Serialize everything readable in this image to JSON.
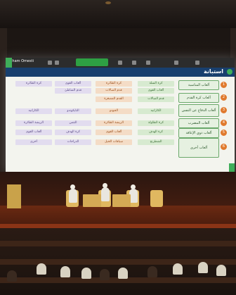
{
  "zoom": {
    "participant_name": "Raham Omesti",
    "poll_label": ""
  },
  "survey": {
    "title": "استبانة"
  },
  "categories": [
    {
      "num": "1",
      "label": "ألعاب المناسبة"
    },
    {
      "num": "2",
      "label": "ألعاب كرة القدم"
    },
    {
      "num": "3",
      "label": "ألعاب الدفاع عن النفس"
    },
    {
      "num": "4",
      "label": "ألعاب المضرب"
    },
    {
      "num": "5",
      "label": "ألعاب ذوي الإعاقة"
    },
    {
      "num": "6",
      "label": "ألعاب أخرى"
    }
  ],
  "grid": [
    [
      "كرة السلة",
      "كرة الطائرة",
      "ألعاب القوى",
      "كرة الطائرة"
    ],
    [
      "ألعاب القوى",
      "قدم الصالات",
      "قدم الشاطئ",
      ""
    ],
    [
      "قدم الصالات",
      "القدم المصغرة",
      "",
      ""
    ],
    [
      "الكاراتيه",
      "الجودو",
      "التايكوندو",
      "الكاراتيه"
    ],
    [
      "كرة الطاولة",
      "الريشة الطائرة",
      "التنس",
      "الريشة الطائرة"
    ],
    [
      "كرة الهدف",
      "ألعاب القوى",
      "كرة الهدف",
      "ألعاب القوى"
    ],
    [
      "الشطرنج",
      "سباقات الخيل",
      "الدراجات",
      "أخرى"
    ]
  ]
}
